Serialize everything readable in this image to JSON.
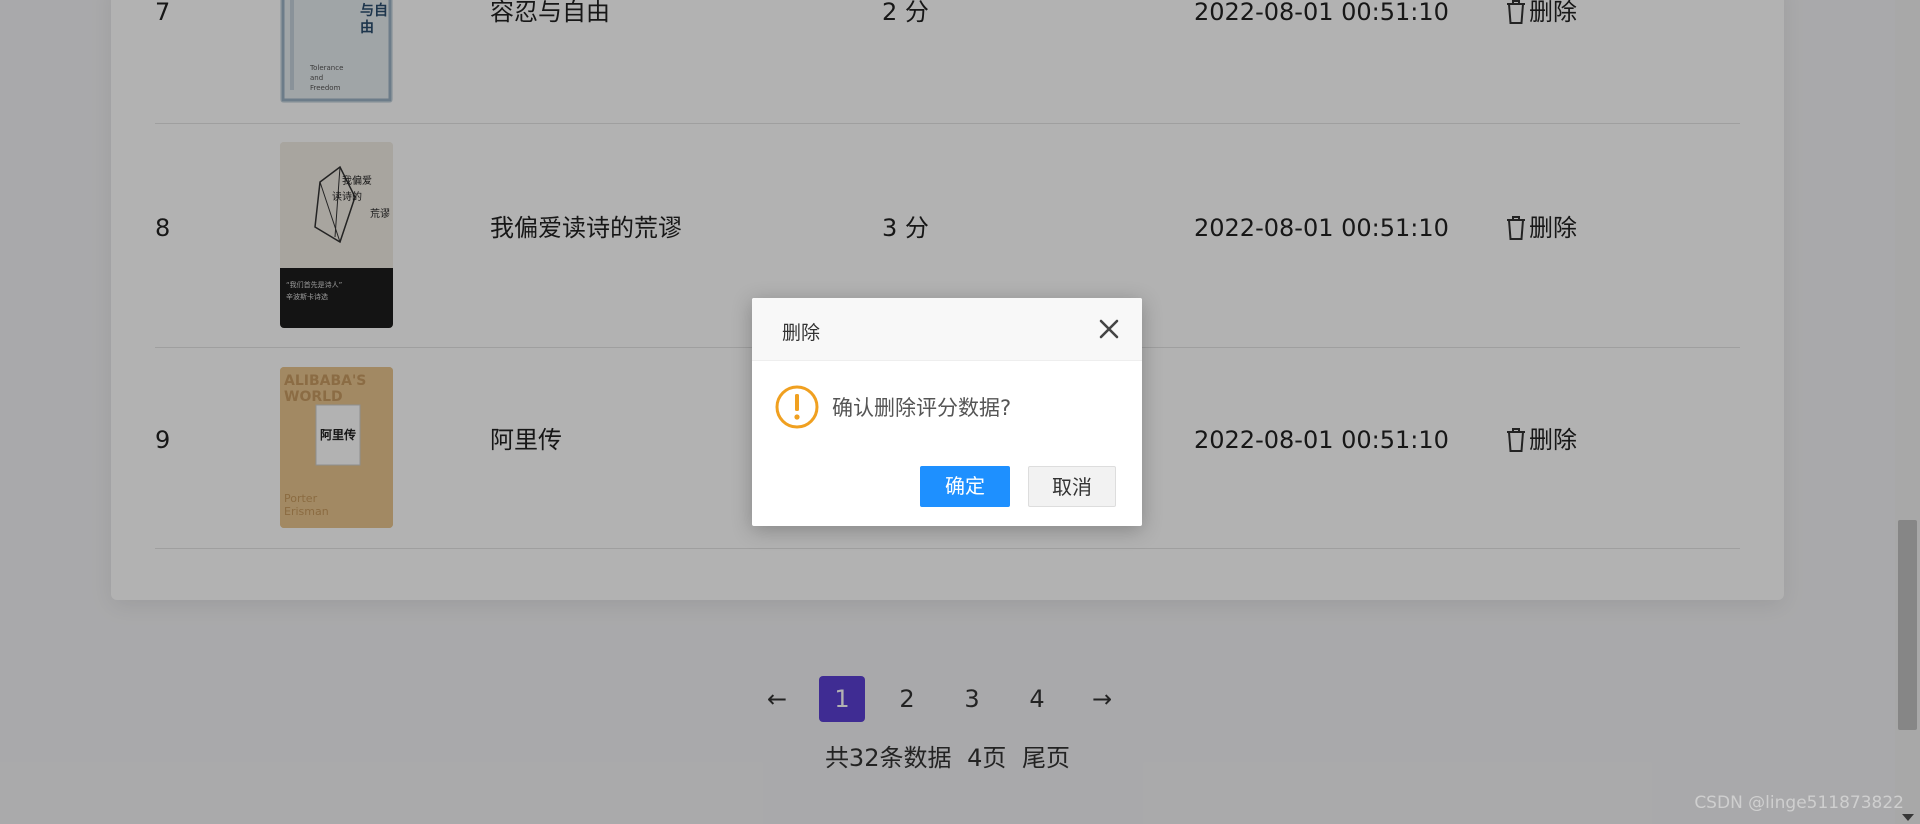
{
  "table": {
    "rows": [
      {
        "index": "7",
        "title": "容忍与自由",
        "score": "2 分",
        "time": "2022-08-01 00:51:10",
        "action": "删除"
      },
      {
        "index": "8",
        "title": "我偏爱读诗的荒谬",
        "score": "3 分",
        "time": "2022-08-01 00:51:10",
        "action": "删除"
      },
      {
        "index": "9",
        "title": "阿里传",
        "score": "",
        "time": "2022-08-01 00:51:10",
        "action": "删除"
      }
    ]
  },
  "pagination": {
    "prev": "←",
    "pages": [
      "1",
      "2",
      "3",
      "4"
    ],
    "active_page": "1",
    "next": "→",
    "total": "共32条数据",
    "page_count": "4页",
    "last": "尾页"
  },
  "modal": {
    "title": "删除",
    "message": "确认删除评分数据?",
    "ok": "确定",
    "cancel": "取消"
  },
  "watermark": "CSDN @linge511873822",
  "colors": {
    "active_page": "#5b3fd3",
    "ok_button": "#1e90ff",
    "warning": "#f0a020"
  }
}
